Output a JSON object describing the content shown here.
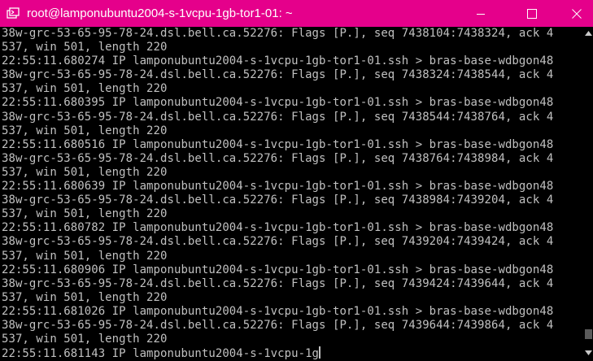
{
  "window": {
    "title": "root@lamponubuntu2004-s-1vcpu-1gb-tor1-01: ~",
    "icon": "terminal-app-icon",
    "colors": {
      "titlebar": "#e5008b",
      "terminal_bg": "#000000",
      "terminal_fg": "#c0c0c0"
    }
  },
  "controls": {
    "minimize": "minimize-icon",
    "maximize": "maximize-icon",
    "close": "close-icon"
  },
  "terminal": {
    "lines": [
      "38w-grc-53-65-95-78-24.dsl.bell.ca.52276: Flags [P.], seq 7438104:7438324, ack 4",
      "537, win 501, length 220",
      "22:55:11.680274 IP lamponubuntu2004-s-1vcpu-1gb-tor1-01.ssh > bras-base-wdbgon48",
      "38w-grc-53-65-95-78-24.dsl.bell.ca.52276: Flags [P.], seq 7438324:7438544, ack 4",
      "537, win 501, length 220",
      "22:55:11.680395 IP lamponubuntu2004-s-1vcpu-1gb-tor1-01.ssh > bras-base-wdbgon48",
      "38w-grc-53-65-95-78-24.dsl.bell.ca.52276: Flags [P.], seq 7438544:7438764, ack 4",
      "537, win 501, length 220",
      "22:55:11.680516 IP lamponubuntu2004-s-1vcpu-1gb-tor1-01.ssh > bras-base-wdbgon48",
      "38w-grc-53-65-95-78-24.dsl.bell.ca.52276: Flags [P.], seq 7438764:7438984, ack 4",
      "537, win 501, length 220",
      "22:55:11.680639 IP lamponubuntu2004-s-1vcpu-1gb-tor1-01.ssh > bras-base-wdbgon48",
      "38w-grc-53-65-95-78-24.dsl.bell.ca.52276: Flags [P.], seq 7438984:7439204, ack 4",
      "537, win 501, length 220",
      "22:55:11.680782 IP lamponubuntu2004-s-1vcpu-1gb-tor1-01.ssh > bras-base-wdbgon48",
      "38w-grc-53-65-95-78-24.dsl.bell.ca.52276: Flags [P.], seq 7439204:7439424, ack 4",
      "537, win 501, length 220",
      "22:55:11.680906 IP lamponubuntu2004-s-1vcpu-1gb-tor1-01.ssh > bras-base-wdbgon48",
      "38w-grc-53-65-95-78-24.dsl.bell.ca.52276: Flags [P.], seq 7439424:7439644, ack 4",
      "537, win 501, length 220",
      "22:55:11.681026 IP lamponubuntu2004-s-1vcpu-1gb-tor1-01.ssh > bras-base-wdbgon48",
      "38w-grc-53-65-95-78-24.dsl.bell.ca.52276: Flags [P.], seq 7439644:7439864, ack 4",
      "537, win 501, length 220",
      "22:55:11.681143 IP lamponubuntu2004-s-1vcpu-1g"
    ]
  },
  "scrollbar": {
    "up": "scroll-up-arrow-icon",
    "down": "scroll-down-arrow-icon"
  }
}
